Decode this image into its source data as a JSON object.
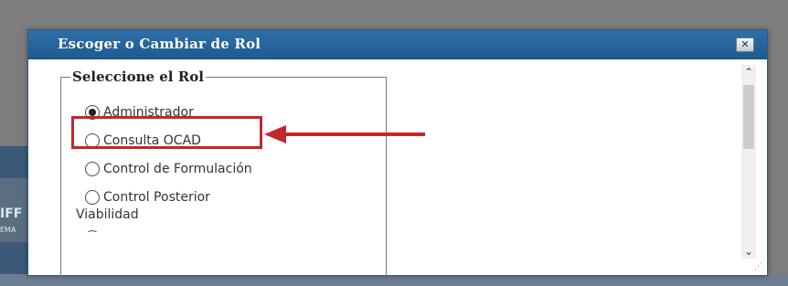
{
  "background": {
    "partial_text_1": "IFF",
    "partial_text_2": "EMA"
  },
  "dialog": {
    "title": "Escoger o Cambiar de Rol",
    "close_icon": "close-icon",
    "group_legend": "Seleccione el Rol",
    "options": [
      {
        "label": "Administrador",
        "checked": true
      },
      {
        "label": "Consulta OCAD",
        "checked": false
      },
      {
        "label": "Control de Formulación",
        "checked": false
      },
      {
        "label_line1": "Control Posterior",
        "label_line2": "Viabilidad",
        "checked": false
      },
      {
        "label": "",
        "checked": false
      }
    ],
    "scroll_up_icon": "chevron-up-icon",
    "scroll_down_icon": "chevron-down-icon"
  },
  "colors": {
    "titlebar": "#1f5a92",
    "highlight": "#c1272d",
    "arrow": "#c1272d"
  }
}
